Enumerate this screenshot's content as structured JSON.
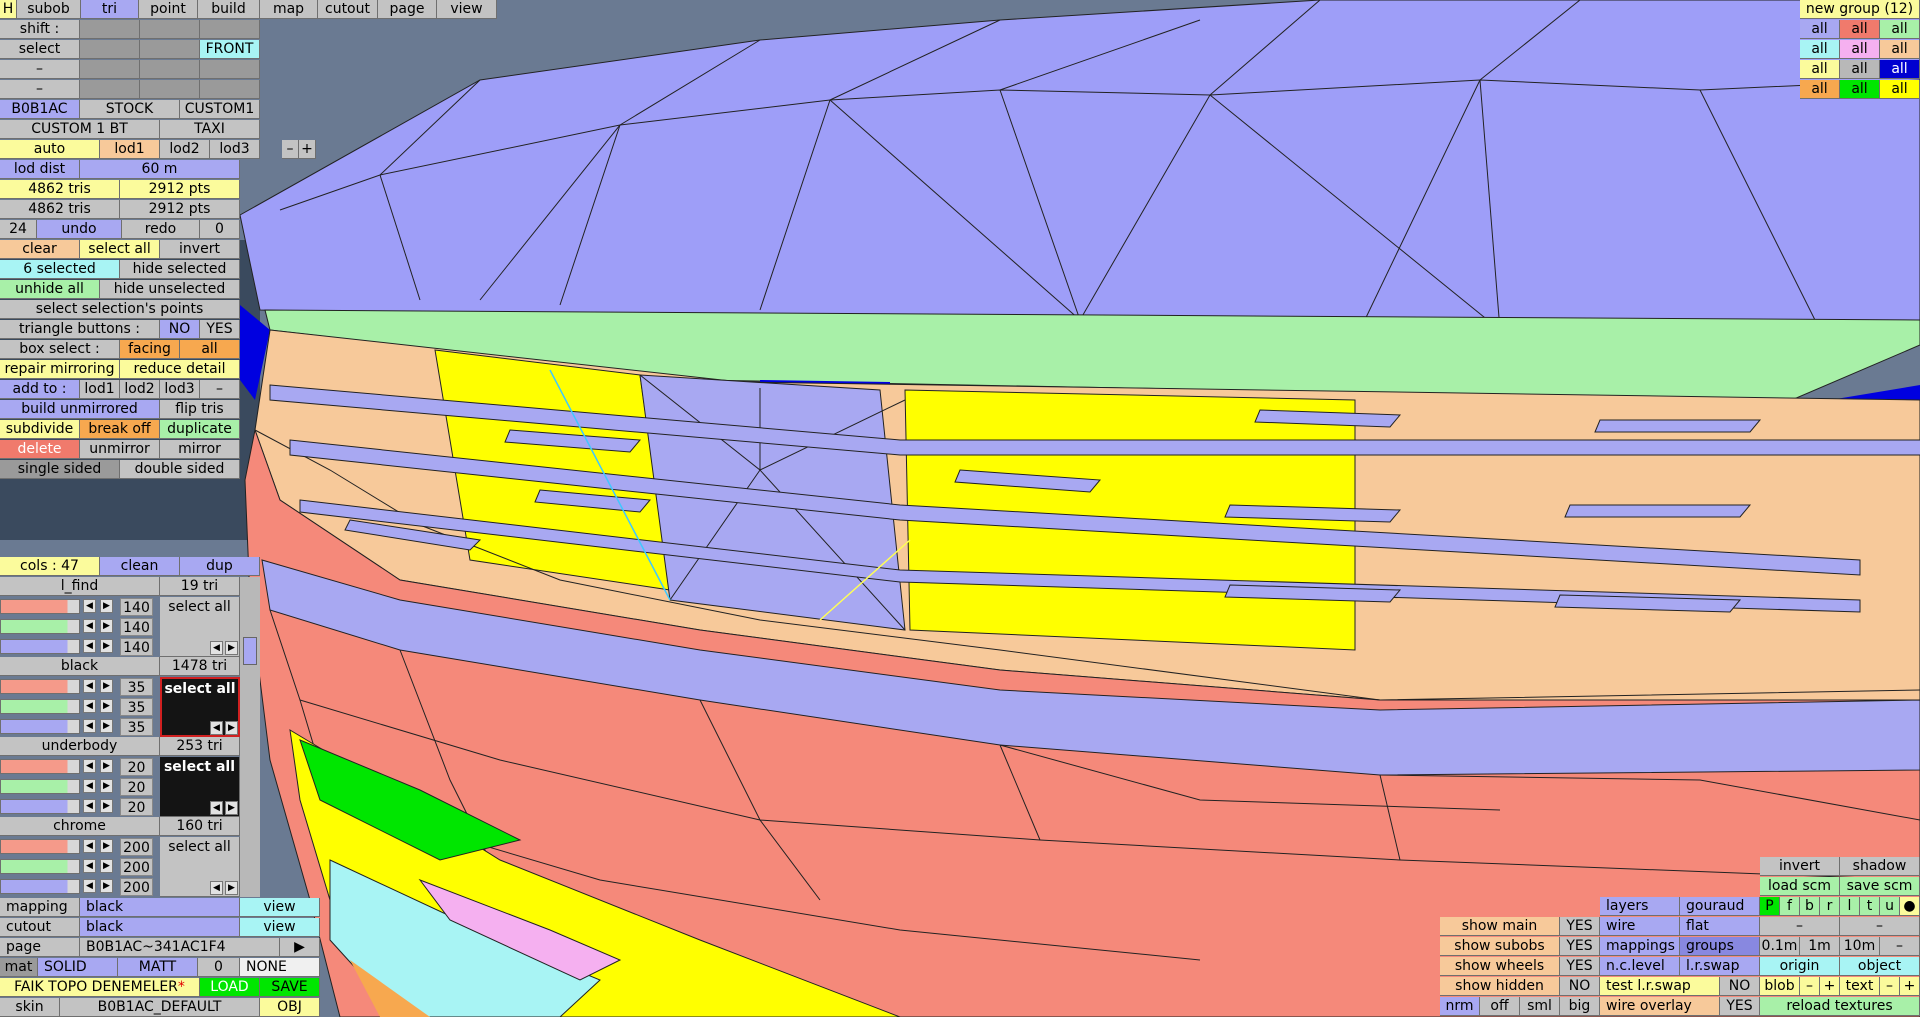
{
  "top_menu": {
    "h": "H",
    "items": [
      "subob",
      "tri",
      "point",
      "build",
      "map",
      "cutout",
      "page",
      "view"
    ],
    "active": "tri"
  },
  "left_panel": {
    "shift_label": "shift :",
    "select_label": "select",
    "front_label": "FRONT",
    "dash_label": "–",
    "configs": [
      "B0B1AC",
      "STOCK",
      "CUSTOM1"
    ],
    "configs2": [
      "CUSTOM 1 BT",
      "TAXI"
    ],
    "lod_auto": "auto",
    "lods": [
      "lod1",
      "lod2",
      "lod3"
    ],
    "lod_minus": "–",
    "lod_plus": "+",
    "lod_dist_label": "lod dist",
    "lod_dist_value": "60 m",
    "stats": [
      {
        "tris": "4862 tris",
        "pts": "2912 pts"
      },
      {
        "tris": "4862 tris",
        "pts": "2912 pts"
      }
    ],
    "undo_count": "24",
    "undo": "undo",
    "redo": "redo",
    "redo_count": "0",
    "clear": "clear",
    "select_all": "select all",
    "invert": "invert",
    "selected": "6 selected",
    "hide_selected": "hide selected",
    "unhide_all": "unhide all",
    "hide_unselected": "hide unselected",
    "select_points": "select selection's points",
    "triangle_buttons": "triangle buttons :",
    "no": "NO",
    "yes": "YES",
    "box_select": "box select :",
    "facing": "facing",
    "all": "all",
    "repair_mirroring": "repair mirroring",
    "reduce_detail": "reduce detail",
    "add_to": "add to :",
    "add_lods": [
      "lod1",
      "lod2",
      "lod3"
    ],
    "add_minus": "–",
    "build_unmirrored": "build unmirrored",
    "flip_tris": "flip tris",
    "subdivide": "subdivide",
    "break_off": "break off",
    "duplicate": "duplicate",
    "delete": "delete",
    "unmirror": "unmirror",
    "mirror": "mirror",
    "single_sided": "single sided",
    "double_sided": "double sided"
  },
  "materials_panel": {
    "cols": "cols : 47",
    "clean": "clean",
    "dup": "dup",
    "materials": [
      {
        "name": "l_find",
        "tris": "19 tri",
        "rgb": [
          "140",
          "140",
          "140"
        ],
        "btn": "select all",
        "dark": false
      },
      {
        "name": "black",
        "tris": "1478 tri",
        "rgb": [
          "35",
          "35",
          "35"
        ],
        "btn": "select all",
        "dark": true
      },
      {
        "name": "underbody",
        "tris": "253 tri",
        "rgb": [
          "20",
          "20",
          "20"
        ],
        "btn": "select all",
        "dark": true
      },
      {
        "name": "chrome",
        "tris": "160 tri",
        "rgb": [
          "200",
          "200",
          "200"
        ],
        "btn": "select all",
        "dark": false
      }
    ]
  },
  "bottom_left": {
    "mapping_label": "mapping",
    "mapping_value": "black",
    "cutout_label": "cutout",
    "cutout_value": "black",
    "view": "view",
    "page_label": "page",
    "page_value": "B0B1AC~341AC1F4",
    "page_arrow": "▶",
    "mat_label": "mat",
    "mat_solid": "SOLID",
    "mat_matt": "MATT",
    "mat_num": "0",
    "mat_none": "NONE",
    "file_name": "FAIK TOPO DENEMELER",
    "file_star": "*",
    "load": "LOAD",
    "save": "SAVE",
    "skin_label": "skin",
    "skin_value": "B0B1AC_DEFAULT",
    "obj": "OBJ"
  },
  "group_panel": {
    "title": "new group (12)",
    "all": "all"
  },
  "bottom_right": {
    "invert": "invert",
    "shadow": "shadow",
    "load_scm": "load scm",
    "save_scm": "save scm",
    "show_main": "show main",
    "show_subobs": "show subobs",
    "show_wheels": "show wheels",
    "show_hidden": "show hidden",
    "yes": "YES",
    "no": "NO",
    "nrm": "nrm",
    "off": "off",
    "sml": "sml",
    "big": "big",
    "layers": "layers",
    "gouraud": "gouraud",
    "wire": "wire",
    "flat": "flat",
    "mappings": "mappings",
    "groups": "groups",
    "nc_level": "n.c.level",
    "lr_swap": "l.r.swap",
    "test_lr_swap": "test l.r.swap",
    "wire_overlay": "wire overlay",
    "pfbrltu": [
      "P",
      "f",
      "b",
      "r",
      "l",
      "t",
      "u",
      "●"
    ],
    "dash": "–",
    "dists": [
      "0.1m",
      "1m",
      "10m"
    ],
    "origin": "origin",
    "object": "object",
    "blob": "blob",
    "text": "text",
    "minus": "–",
    "plus": "+",
    "reload_textures": "reload textures"
  },
  "colors": {
    "blue": "#a8a8f2",
    "peach": "#f7c99a",
    "salmon": "#f5897a",
    "yellow": "#ffff00",
    "green": "#a8f0a8",
    "cyan": "#a8f4f4"
  }
}
